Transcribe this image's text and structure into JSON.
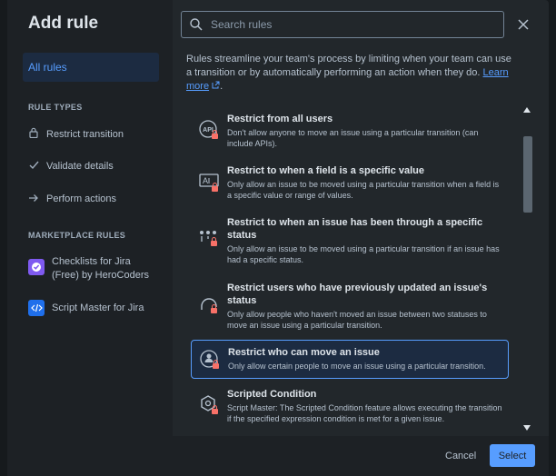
{
  "dialog": {
    "title": "Add rule",
    "search_placeholder": "Search rules",
    "intro_text": "Rules streamline your team's process by limiting when your team can use a transition or by automatically performing an action when they do.",
    "learn_more": "Learn more",
    "intro_end": "."
  },
  "sidebar": {
    "all_rules": "All rules",
    "rule_types_heading": "RULE TYPES",
    "rule_types": [
      {
        "label": "Restrict transition",
        "icon": "lock-icon"
      },
      {
        "label": "Validate details",
        "icon": "check-icon"
      },
      {
        "label": "Perform actions",
        "icon": "arrow-right-icon"
      }
    ],
    "marketplace_heading": "MARKETPLACE RULES",
    "marketplace": [
      {
        "label": "Checklists for Jira (Free) by HeroCoders",
        "icon": "checklist-app-icon",
        "color": "#7f5af0"
      },
      {
        "label": "Script Master for Jira",
        "icon": "code-app-icon",
        "color": "#1f6feb"
      }
    ]
  },
  "rules": [
    {
      "title": "Restrict from all users",
      "desc": "Don't allow anyone to move an issue using a particular transition (can include APIs).",
      "icon": "api-lock-icon"
    },
    {
      "title": "Restrict to when a field is a specific value",
      "desc": "Only allow an issue to be moved using a particular transition when a field is a specific value or range of values.",
      "icon": "field-lock-icon"
    },
    {
      "title": "Restrict to when an issue has been through a specific status",
      "desc": "Only allow an issue to be moved using a particular transition if an issue has had a specific status.",
      "icon": "status-lock-icon"
    },
    {
      "title": "Restrict users who have previously updated an issue's status",
      "desc": "Only allow people who haven't moved an issue between two statuses to move an issue using a particular transition.",
      "icon": "user-status-lock-icon"
    },
    {
      "title": "Restrict who can move an issue",
      "desc": "Only allow certain people to move an issue using a particular transition.",
      "icon": "user-lock-icon"
    },
    {
      "title": "Scripted Condition",
      "desc": "Script Master: The Scripted Condition feature allows executing the transition if the specified expression condition is met for a given issue.",
      "icon": "script-lock-icon"
    }
  ],
  "footer": {
    "cancel": "Cancel",
    "select": "Select"
  },
  "colors": {
    "accent": "#579dff",
    "lock_badge": "#f87168",
    "background": "#22272b"
  }
}
